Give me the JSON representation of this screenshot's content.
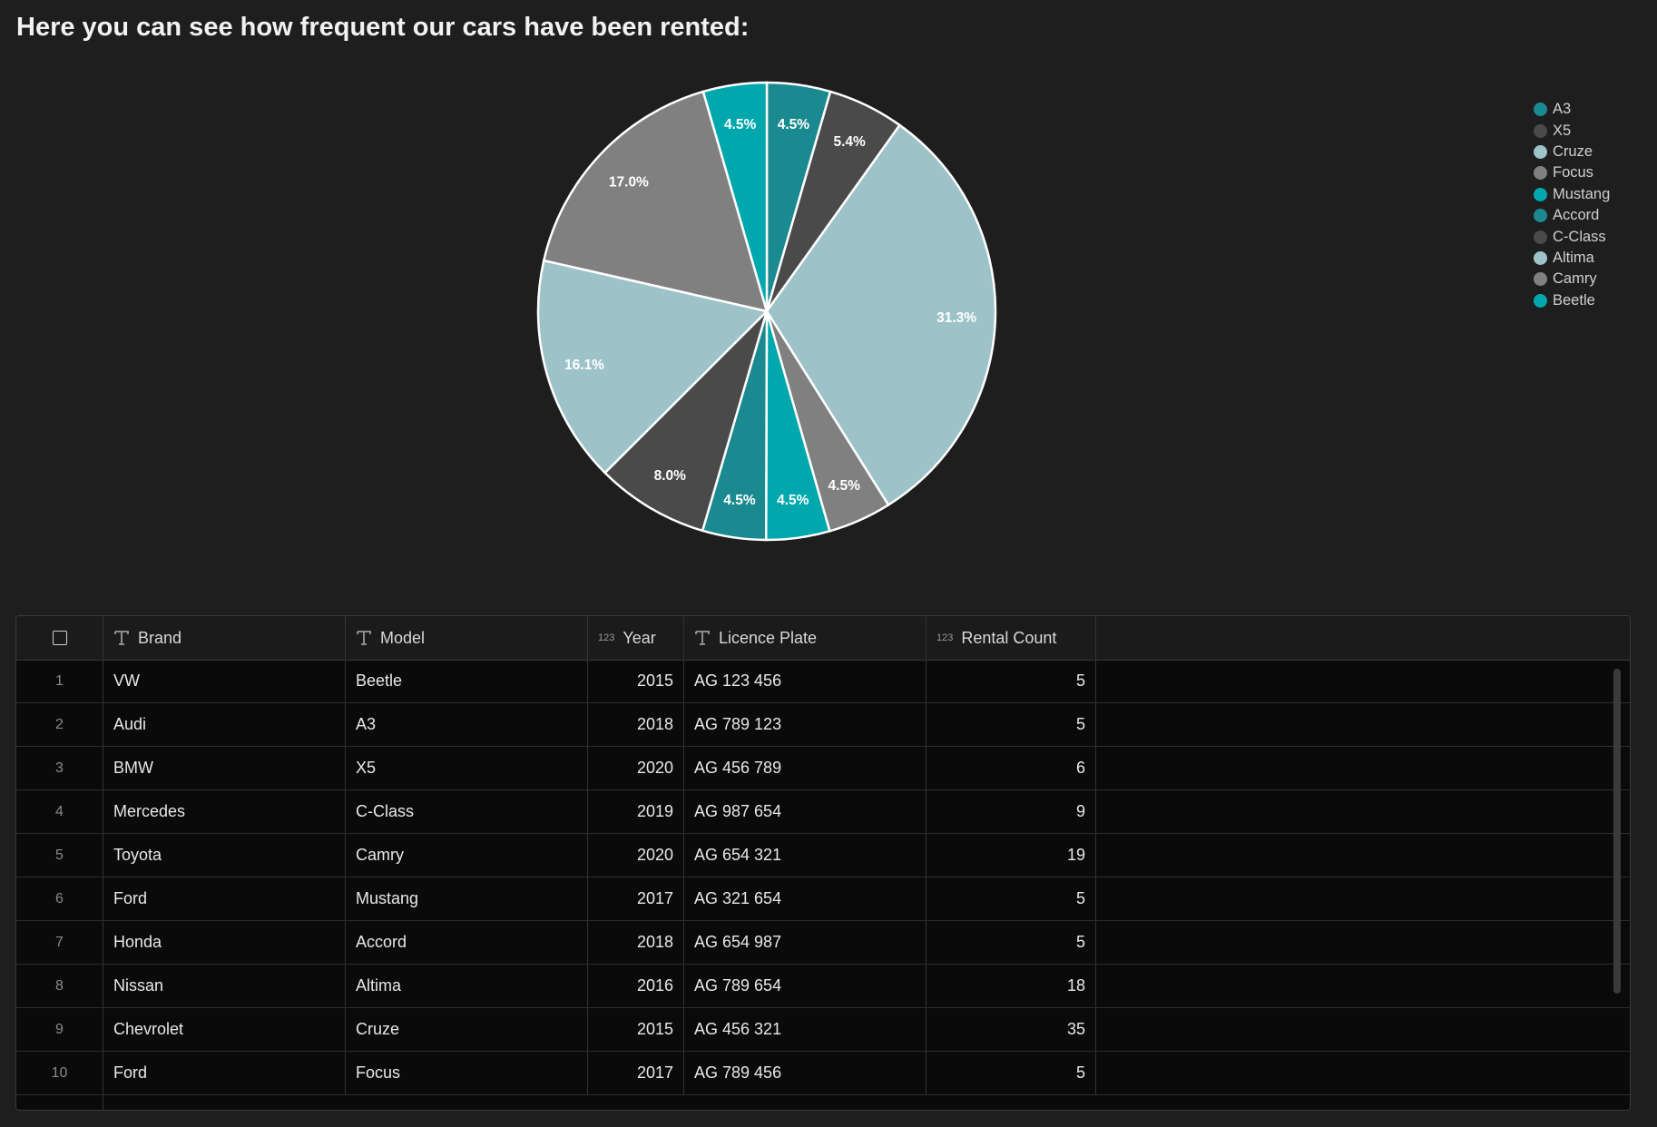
{
  "page": {
    "title": "Here you can see how frequent our cars have been rented:"
  },
  "chart_data": {
    "type": "pie",
    "slices": [
      {
        "label": "A3",
        "value": 4.5,
        "display": "4.5%",
        "color": "#1a8a90"
      },
      {
        "label": "X5",
        "value": 5.4,
        "display": "5.4%",
        "color": "#4a4a4a"
      },
      {
        "label": "Cruze",
        "value": 31.3,
        "display": "31.3%",
        "color": "#9dc3c8"
      },
      {
        "label": "Focus",
        "value": 4.5,
        "display": "4.5%",
        "color": "#808080"
      },
      {
        "label": "Mustang",
        "value": 4.5,
        "display": "4.5%",
        "color": "#00a8ad"
      },
      {
        "label": "Accord",
        "value": 4.5,
        "display": "4.5%",
        "color": "#1a8a90"
      },
      {
        "label": "C-Class",
        "value": 8.0,
        "display": "8.0%",
        "color": "#4a4a4a"
      },
      {
        "label": "Altima",
        "value": 16.1,
        "display": "16.1%",
        "color": "#9dc3c8"
      },
      {
        "label": "Camry",
        "value": 17.0,
        "display": "17.0%",
        "color": "#808080"
      },
      {
        "label": "Beetle",
        "value": 4.5,
        "display": "4.5%",
        "color": "#00a8ad"
      }
    ],
    "legend_position": "top-right"
  },
  "table": {
    "select_all_label": "",
    "columns": [
      {
        "label": "Brand",
        "type_icon": "text-type-icon"
      },
      {
        "label": "Model",
        "type_icon": "text-type-icon"
      },
      {
        "label": "Year",
        "type_icon": "number-type-icon",
        "type_label": "123"
      },
      {
        "label": "Licence Plate",
        "type_icon": "text-type-icon"
      },
      {
        "label": "Rental Count",
        "type_icon": "number-type-icon",
        "type_label": "123"
      }
    ],
    "rows": [
      {
        "idx": "1",
        "brand": "VW",
        "model": "Beetle",
        "year": "2015",
        "plate": "AG 123 456",
        "count": "5"
      },
      {
        "idx": "2",
        "brand": "Audi",
        "model": "A3",
        "year": "2018",
        "plate": "AG 789 123",
        "count": "5"
      },
      {
        "idx": "3",
        "brand": "BMW",
        "model": "X5",
        "year": "2020",
        "plate": "AG 456 789",
        "count": "6"
      },
      {
        "idx": "4",
        "brand": "Mercedes",
        "model": "C-Class",
        "year": "2019",
        "plate": "AG 987 654",
        "count": "9"
      },
      {
        "idx": "5",
        "brand": "Toyota",
        "model": "Camry",
        "year": "2020",
        "plate": "AG 654 321",
        "count": "19"
      },
      {
        "idx": "6",
        "brand": "Ford",
        "model": "Mustang",
        "year": "2017",
        "plate": "AG 321 654",
        "count": "5"
      },
      {
        "idx": "7",
        "brand": "Honda",
        "model": "Accord",
        "year": "2018",
        "plate": "AG 654 987",
        "count": "5"
      },
      {
        "idx": "8",
        "brand": "Nissan",
        "model": "Altima",
        "year": "2016",
        "plate": "AG 789 654",
        "count": "18"
      },
      {
        "idx": "9",
        "brand": "Chevrolet",
        "model": "Cruze",
        "year": "2015",
        "plate": "AG 456 321",
        "count": "35"
      },
      {
        "idx": "10",
        "brand": "Ford",
        "model": "Focus",
        "year": "2017",
        "plate": "AG 789 456",
        "count": "5"
      }
    ]
  }
}
